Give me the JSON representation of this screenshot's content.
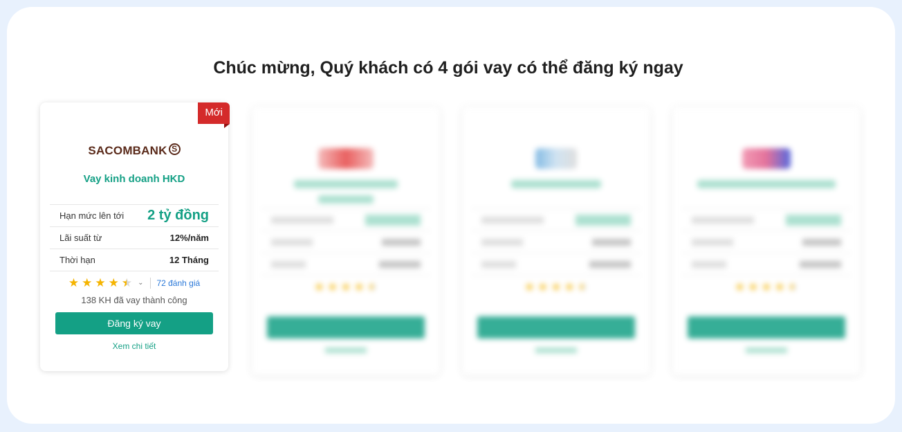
{
  "headline": "Chúc mừng, Quý khách có 4 gói vay có thể đăng ký ngay",
  "colors": {
    "accent": "#14a085",
    "ribbon": "#d42a2a",
    "star": "#f5b400",
    "link": "#2a78d8",
    "frame_border": "#e8f1fd"
  },
  "cards": [
    {
      "badge": "Mới",
      "bank_logo_text": "SACOMBANK",
      "bank_logo_symbol": "S",
      "product_name": "Vay kinh doanh HKD",
      "rows": [
        {
          "label": "Hạn mức lên tới",
          "value": "2 tỷ đồng"
        },
        {
          "label": "Lãi suất từ",
          "value": "12%/năm"
        },
        {
          "label": "Thời hạn",
          "value": "12 Tháng"
        }
      ],
      "rating": {
        "stars": 4.5,
        "reviews": "72 đánh giá",
        "expand_icon": "chevron-down-icon"
      },
      "success_text": "138 KH đã vay thành công",
      "apply_label": "Đăng ký vay",
      "detail_label": "Xem chi tiết"
    },
    {
      "blurred": true,
      "logo_color": "#e64545",
      "product_color_note": "accent"
    },
    {
      "blurred": true,
      "logo_color": "#7fb8e0",
      "product_color_note": "accent"
    },
    {
      "blurred": true,
      "logo_color": "#e05a8a",
      "product_color_note": "accent"
    }
  ]
}
